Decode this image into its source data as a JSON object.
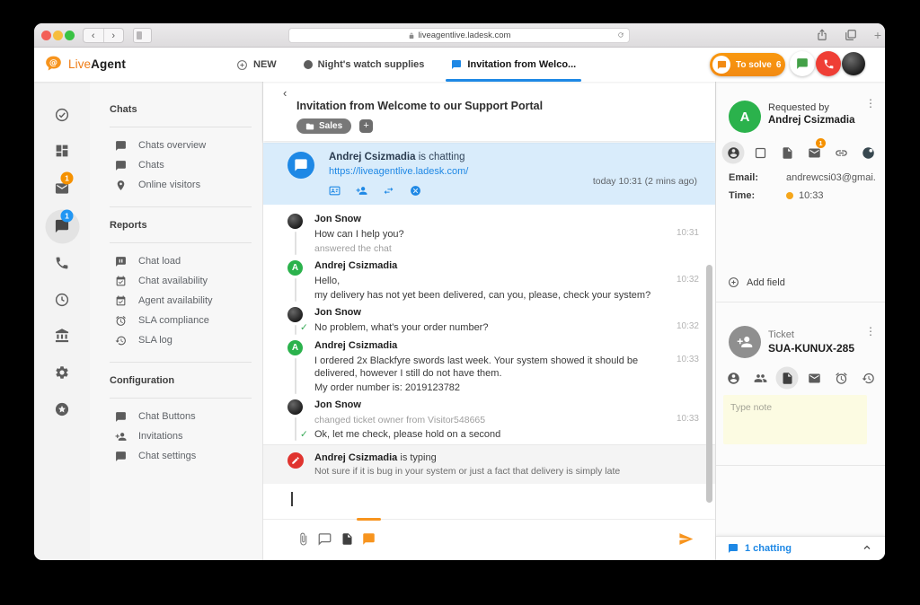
{
  "browser": {
    "url": "liveagentlive.ladesk.com"
  },
  "appbar": {
    "brand_live": "Live",
    "brand_agent": "Agent",
    "tabs": [
      {
        "icon": "plus-circle-icon",
        "label": "NEW",
        "active": false
      },
      {
        "icon": "dot-icon",
        "label": "Night's watch supplies",
        "active": false
      },
      {
        "icon": "chat-icon",
        "label": "Invitation from Welco...",
        "active": true
      }
    ],
    "to_solve": {
      "label": "To solve",
      "count": "6"
    }
  },
  "rail": {
    "items": [
      {
        "icon": "check-circle"
      },
      {
        "icon": "dashboard"
      },
      {
        "icon": "mail",
        "badge": "1"
      },
      {
        "icon": "chat",
        "badge": "1",
        "active": true
      },
      {
        "icon": "phone"
      },
      {
        "icon": "clock"
      },
      {
        "icon": "bank"
      },
      {
        "icon": "settings"
      },
      {
        "icon": "star-circle"
      }
    ]
  },
  "sidebar": {
    "sections": [
      {
        "title": "Chats",
        "items": [
          {
            "icon": "chat",
            "label": "Chats overview"
          },
          {
            "icon": "chat",
            "label": "Chats"
          },
          {
            "icon": "pin",
            "label": "Online visitors"
          }
        ]
      },
      {
        "title": "Reports",
        "items": [
          {
            "icon": "chat-poll",
            "label": "Chat load"
          },
          {
            "icon": "calendar-check",
            "label": "Chat availability"
          },
          {
            "icon": "calendar-check",
            "label": "Agent availability"
          },
          {
            "icon": "alarm",
            "label": "SLA compliance"
          },
          {
            "icon": "history",
            "label": "SLA log"
          }
        ]
      },
      {
        "title": "Configuration",
        "items": [
          {
            "icon": "chat",
            "label": "Chat Buttons"
          },
          {
            "icon": "person-add",
            "label": "Invitations"
          },
          {
            "icon": "chat",
            "label": "Chat settings"
          }
        ]
      }
    ]
  },
  "chat": {
    "back": "‹",
    "title": "Invitation from Welcome to our Support Portal",
    "tag": {
      "icon": "folder-icon",
      "label": "Sales"
    },
    "banner": {
      "name": "Andrej Csizmadia",
      "status": "is chatting",
      "link": "https://liveagentlive.ladesk.com/",
      "timestamp": "today 10:31 (2 mins ago)"
    },
    "messages": [
      {
        "author": "Jon Snow",
        "avatar": "photo",
        "time": "10:31",
        "lines": [
          {
            "text": "How can I help you?"
          },
          {
            "text": "answered the chat",
            "meta": true
          }
        ]
      },
      {
        "author": "Andrej Csizmadia",
        "avatar_text": "A",
        "time": "10:32",
        "lines": [
          {
            "text": "Hello,"
          },
          {
            "text": "my delivery has not yet been delivered, can you, please, check your system?"
          }
        ]
      },
      {
        "author": "Jon Snow",
        "avatar": "photo",
        "time": "10:32",
        "lines": [
          {
            "text": "No problem, what's your order number?",
            "check": true
          }
        ]
      },
      {
        "author": "Andrej Csizmadia",
        "avatar_text": "A",
        "time": "10:33",
        "lines": [
          {
            "text": "I ordered 2x Blackfyre swords last week. Your system showed it should be delivered, however I still do not have them."
          },
          {
            "text": "My order number is: 2019123782"
          }
        ]
      },
      {
        "author": "Jon Snow",
        "avatar": "photo",
        "time": "10:33",
        "lines": [
          {
            "text": "changed ticket owner from Visitor548665",
            "meta": true
          },
          {
            "text": "Ok, let me check, please hold on a second",
            "check": true
          }
        ]
      }
    ],
    "typing": {
      "name": "Andrej Csizmadia",
      "status": "is typing",
      "preview": "Not sure if it is bug in your system or just a fact that delivery is simply late"
    }
  },
  "info": {
    "requested_by_label": "Requested by",
    "requester_name": "Andrej Csizmadia",
    "requester_initial": "A",
    "email_label": "Email:",
    "email_value": "andrewcsi03@gmai...",
    "time_label": "Time:",
    "time_value": "10:33",
    "add_field_label": "Add field",
    "ticket_label": "Ticket",
    "ticket_id": "SUA-KUNUX-285",
    "note_placeholder": "Type note",
    "footer": {
      "chatting": "1 chatting"
    }
  },
  "colors": {
    "accent_orange": "#f7941e",
    "accent_blue": "#1e88e5",
    "green": "#2bb24c",
    "red": "#e0342f",
    "note_yellow": "#fcfbe2"
  }
}
